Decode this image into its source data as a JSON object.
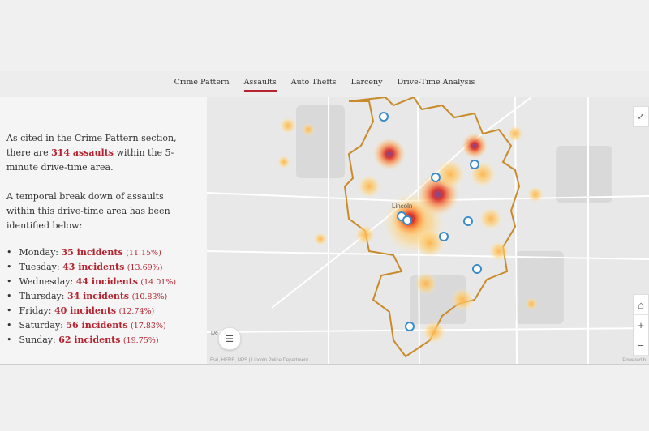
{
  "nav": {
    "tabs": [
      {
        "label": "Crime Pattern",
        "active": false
      },
      {
        "label": "Assaults",
        "active": true
      },
      {
        "label": "Auto Thefts",
        "active": false
      },
      {
        "label": "Larceny",
        "active": false
      },
      {
        "label": "Drive-Time Analysis",
        "active": false
      }
    ]
  },
  "panel": {
    "intro_pre": "As cited in the Crime Pattern section, there are ",
    "intro_highlight": "314 assaults",
    "intro_post": " within the 5-minute drive-time area.",
    "breakdown": "A temporal break down of assaults within this drive-time area has been identified below:",
    "days": [
      {
        "day": "Monday:",
        "incidents": "35 incidents",
        "pct": "(11.15%)"
      },
      {
        "day": "Tuesday:",
        "incidents": "43 incidents",
        "pct": "(13.69%)"
      },
      {
        "day": "Wednesday:",
        "incidents": "44 incidents",
        "pct": "(14.01%)"
      },
      {
        "day": "Thursday:",
        "incidents": "34 incidents",
        "pct": "(10.83%)"
      },
      {
        "day": "Friday:",
        "incidents": "40 incidents",
        "pct": "(12.74%)"
      },
      {
        "day": "Saturday:",
        "incidents": "56 incidents",
        "pct": "(17.83%)"
      },
      {
        "day": "Sunday:",
        "incidents": "62 incidents",
        "pct": "(19.75%)"
      }
    ]
  },
  "map": {
    "city_label": "Lincoln",
    "partial_label": "De",
    "attribution": "Esri, HERE, NPS | Lincoln Police Department",
    "powered": "Powered b",
    "zoom_in": "+",
    "zoom_out": "−",
    "icons": {
      "expand": "expand-icon",
      "legend": "legend-list-icon",
      "home": "home-icon",
      "police": "police-station-icon"
    }
  },
  "colors": {
    "accent": "#b4232f",
    "boundary": "#c98a2a",
    "heat_low": "#ffd27a",
    "heat_high": "#d8261f"
  }
}
